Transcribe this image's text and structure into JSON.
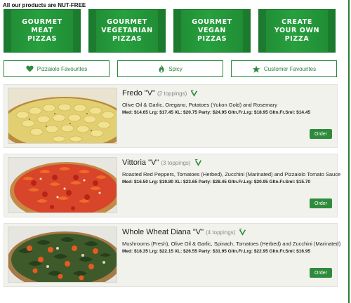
{
  "notice": "All our products are NUT-FREE",
  "categories": [
    "GOURMET\nMEAT\nPIZZAS",
    "GOURMET\nVEGETARIAN\nPIZZAS",
    "GOURMET\nVEGAN\nPIZZAS",
    "CREATE\nYOUR OWN\nPIZZA"
  ],
  "filters": [
    {
      "label": "Pizzaiolo Favourites",
      "icon": "heart-icon"
    },
    {
      "label": "Spicy",
      "icon": "flame-icon"
    },
    {
      "label": "Customer Favourites",
      "icon": "star-icon"
    }
  ],
  "colors": {
    "accent": "#2e8b3c",
    "card_bg": "#f2f2ed"
  },
  "order_label": "Order",
  "products": [
    {
      "name": "Fredo \"V\"",
      "toppings": "(2 toppings)",
      "description": "Olive Oil & Garlic, Oregano, Potatoes (Yukon Gold) and Rosemary",
      "prices": "Med: $14.65  Lrg: $17.45  XL: $20.75  Party: $24.95  Gltn.Fr.Lrg: $18.95  Gltn.Fr.Sml: $14.45"
    },
    {
      "name": "Vittoria \"V\"",
      "toppings": "(3 toppings)",
      "description": "Roasted Red Peppers, Tomatoes (Herbed), Zucchini (Marinated) and Pizzaiolo Tomato Sauce",
      "prices": "Med: $16.50  Lrg: $19.80  XL: $23.65  Party: $28.45  Gltn.Fr.Lrg: $20.95  Gltn.Fr.Sml: $15.70"
    },
    {
      "name": "Whole Wheat Diana \"V\"",
      "toppings": "(4 toppings)",
      "description": "Mushrooms (Fresh), Olive Oil & Garlic, Spinach, Tomatoes (Herbed) and Zucchini (Marinated)",
      "prices": "Med: $18.35  Lrg: $22.15  XL: $26.55  Party: $31.95  Gltn.Fr.Lrg: $22.95  Gltn.Fr.Sml: $16.95"
    }
  ]
}
